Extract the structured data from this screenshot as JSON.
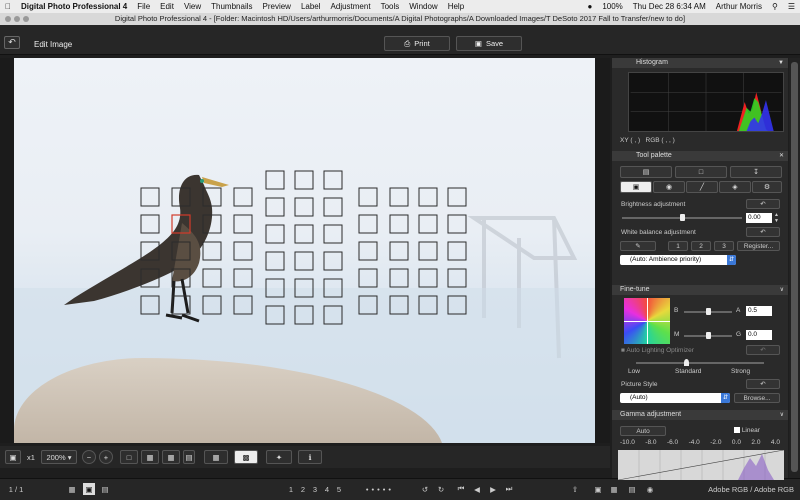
{
  "menubar": {
    "app": "Digital Photo Professional 4",
    "items": [
      "File",
      "Edit",
      "View",
      "Thumbnails",
      "Preview",
      "Label",
      "Adjustment",
      "Tools",
      "Window",
      "Help"
    ],
    "battery": "100%",
    "datetime": "Thu Dec 28  6:34 AM",
    "user": "Arthur Morris"
  },
  "window": {
    "title": "Digital Photo Professional 4 - [Folder: Macintosh HD/Users/arthurmorris/Documents/A Digital Photographs/A Downloaded Images/T DeSoto 2017 Fall to Transfer/new to do]"
  },
  "toolbar": {
    "mode_label": "Edit Image",
    "print_label": "Print",
    "save_label": "Save",
    "back_icon": "back-arrow-icon"
  },
  "viewer": {
    "zoom_fit": "x1",
    "zoom_level": "200%",
    "page_counter": "1 / 1",
    "ratings": [
      "1",
      "2",
      "3",
      "4",
      "5"
    ],
    "color_space": "Adobe RGB / Adobe RGB"
  },
  "panel": {
    "histogram_title": "Histogram",
    "xy_label": "XY (        ,        )",
    "rgb_label": "RGB (        ,        ,        )",
    "tool_palette_title": "Tool palette",
    "brightness": {
      "label": "Brightness adjustment",
      "value": "0.00",
      "level": 0.5
    },
    "white_balance": {
      "label": "White balance adjustment",
      "buttons": [
        "1",
        "2",
        "3"
      ],
      "register_label": "Register...",
      "selected": "(Auto: Ambience priority)"
    },
    "finetune": {
      "title": "Fine-tune",
      "b_label": "B",
      "a_label": "A",
      "a_value": "0.5",
      "m_label": "M",
      "g_label": "G",
      "g_value": "0.0",
      "alo_label": "Auto Lighting Optimizer",
      "levels": [
        "Low",
        "Standard",
        "Strong"
      ]
    },
    "picture_style": {
      "label": "Picture Style",
      "selected": "(Auto)",
      "browse_label": "Browse..."
    },
    "gamma": {
      "title": "Gamma adjustment",
      "auto_label": "Auto",
      "linear_label": "Linear",
      "ticks": [
        "-10.0",
        "-8.0",
        "-6.0",
        "-4.0",
        "-2.0",
        "0.0",
        "2.0",
        "4.0"
      ]
    }
  }
}
